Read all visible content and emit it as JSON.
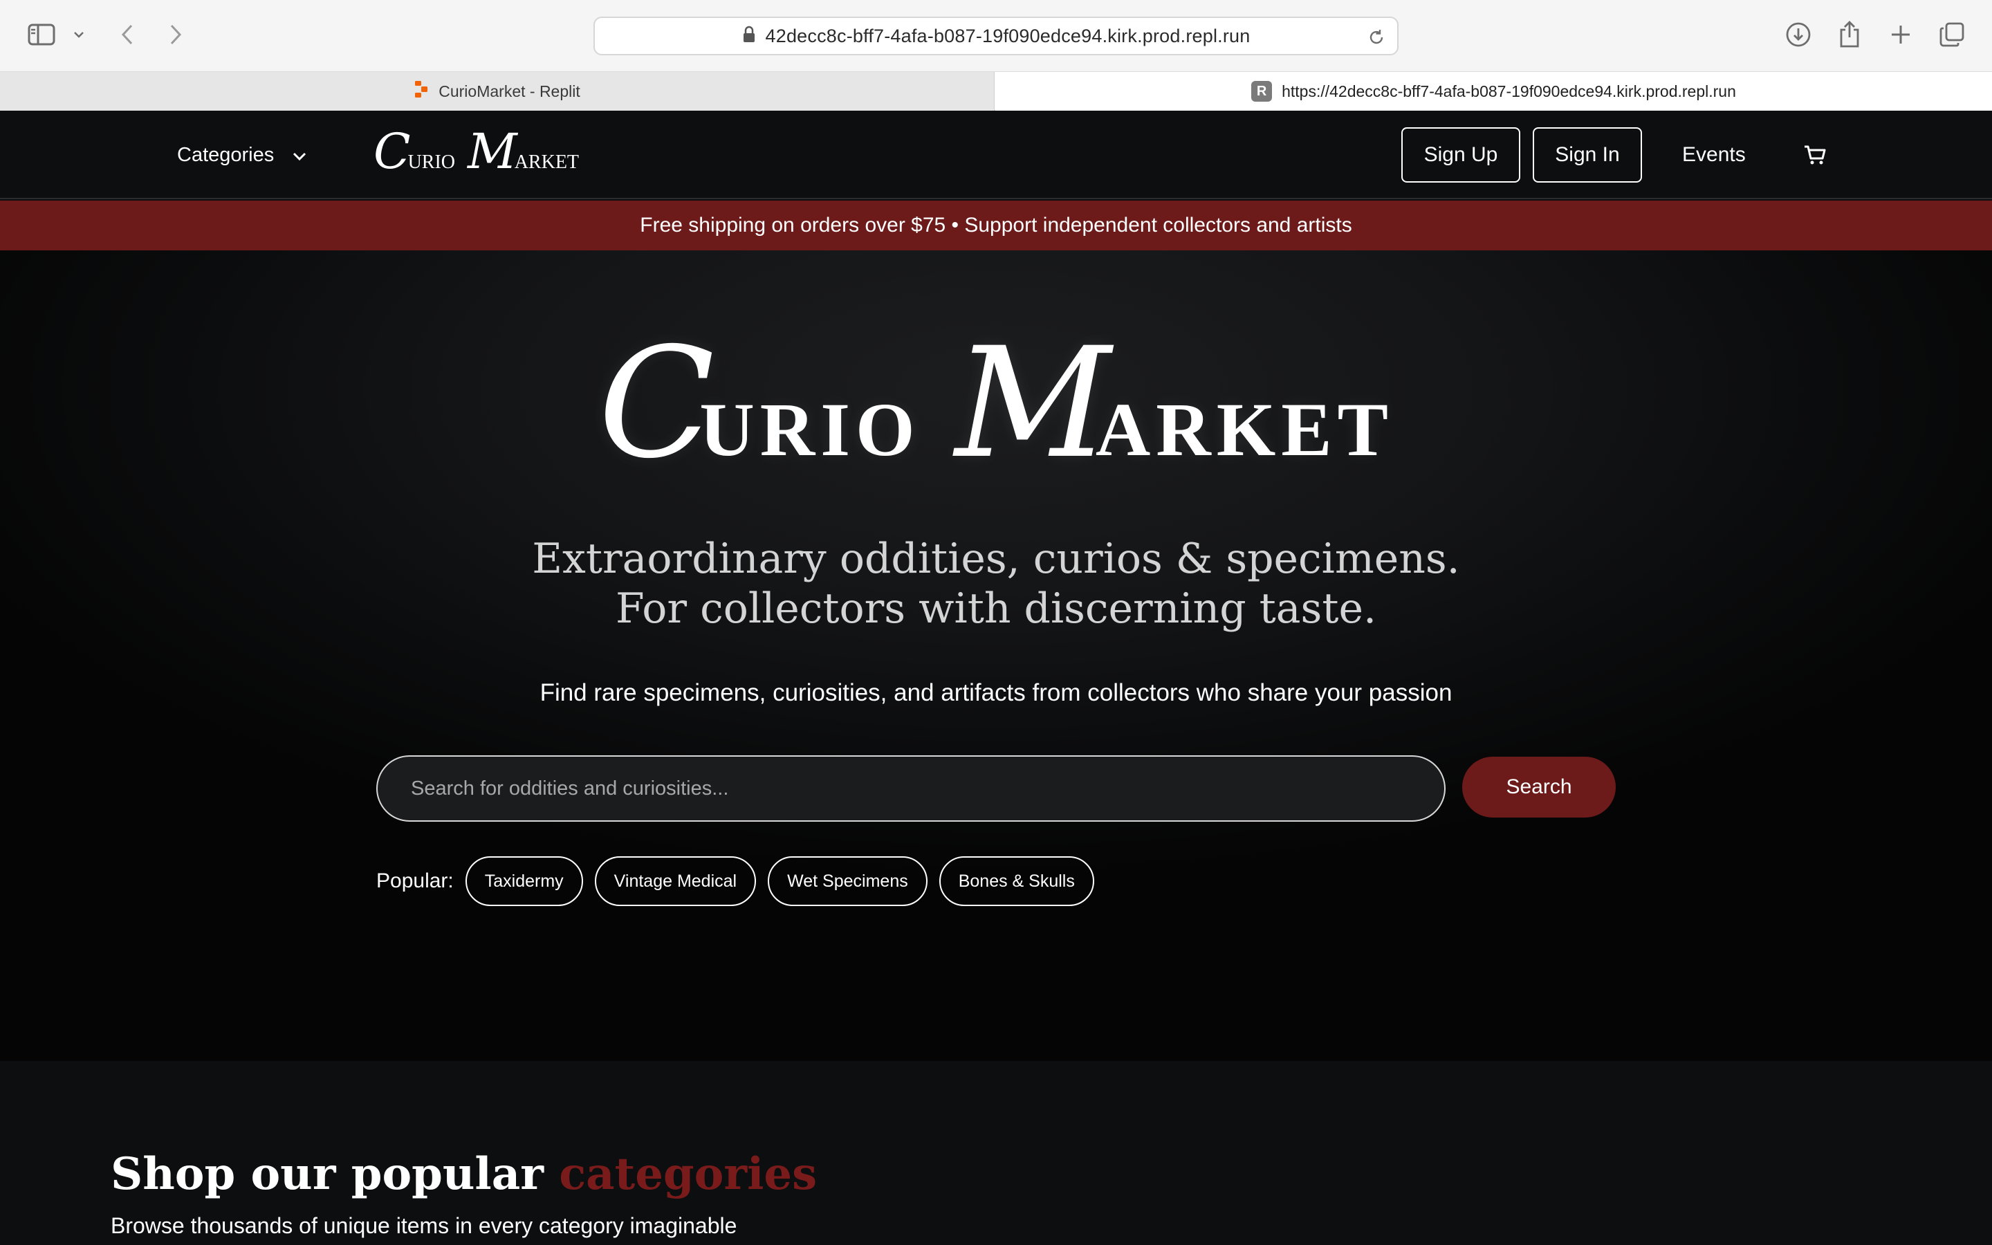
{
  "browser": {
    "url": "42decc8c-bff7-4afa-b087-19f090edce94.kirk.prod.repl.run",
    "tabs": [
      {
        "title": "CurioMarket - Replit",
        "active": false
      },
      {
        "title": "https://42decc8c-bff7-4afa-b087-19f090edce94.kirk.prod.repl.run",
        "active": true
      }
    ]
  },
  "nav": {
    "categories_label": "Categories",
    "logo": {
      "c1": "C",
      "rest1": "urio",
      "c2": "M",
      "rest2": "arket"
    },
    "signup_label": "Sign Up",
    "signin_label": "Sign In",
    "events_label": "Events"
  },
  "promo": {
    "text": "Free shipping on orders over $75 • Support independent collectors and artists"
  },
  "hero": {
    "logo": {
      "c1": "C",
      "rest1": "URIO",
      "c2": "M",
      "rest2": "ARKET"
    },
    "tagline_line1": "Extraordinary oddities, curios & specimens.",
    "tagline_line2": "For collectors with discerning taste.",
    "subtagline": "Find rare specimens, curiosities, and artifacts from collectors who share your passion",
    "search_placeholder": "Search for oddities and curiosities...",
    "search_value": "",
    "search_button": "Search",
    "popular_label": "Popular:",
    "popular_tags": [
      "Taxidermy",
      "Vintage Medical",
      "Wet Specimens",
      "Bones & Skulls"
    ]
  },
  "categories_section": {
    "title_plain": "Shop our popular ",
    "title_accent": "categories",
    "subtitle": "Browse thousands of unique items in every category imaginable"
  },
  "colors": {
    "brand_red": "#6c1a1a",
    "accent_red": "#7a1b1b",
    "page_bg": "#0c0e0f"
  },
  "icons": [
    "sidebar-icon",
    "chevron-down-icon",
    "back-icon",
    "forward-icon",
    "lock-icon",
    "reload-icon",
    "download-icon",
    "share-icon",
    "plus-icon",
    "tabs-overview-icon",
    "replit-icon",
    "cart-icon"
  ]
}
